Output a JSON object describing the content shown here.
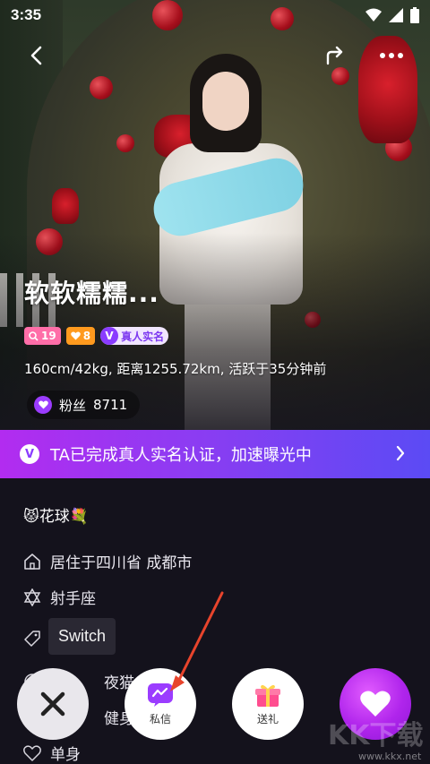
{
  "status": {
    "time": "3:35"
  },
  "profile": {
    "name": "软软糯糯...",
    "badges": {
      "level1": "19",
      "level2": "8",
      "verified_label": "真人实名"
    },
    "stats": "160cm/42kg, 距离1255.72km, 活跃于35分钟前",
    "fans_label": "粉丝",
    "fans_count": "8711"
  },
  "banner": {
    "text": "TA已完成真人实名认证，加速曝光中"
  },
  "info": {
    "nickname": "😾花球💐",
    "residence": "居住于四川省 成都市",
    "zodiac": "射手座",
    "tag_row_1": "夜猫",
    "tag_row_2": "健身",
    "relationship": "单身"
  },
  "tooltip": {
    "text": "Switch"
  },
  "actions": {
    "message_label": "私信",
    "gift_label": "送礼"
  },
  "watermark": {
    "main": "KK下载",
    "sub": "www.kkx.net"
  },
  "colors": {
    "accent_purple": "#8a3cff",
    "banner_start": "#b22cf0",
    "banner_end": "#5b4bf4"
  }
}
